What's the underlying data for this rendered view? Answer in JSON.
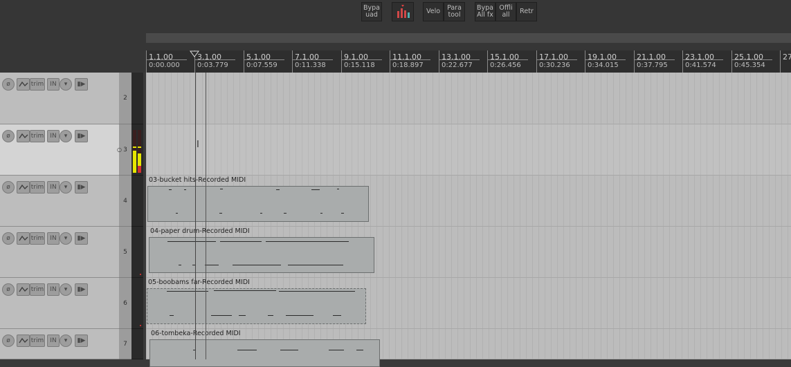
{
  "toolbar": {
    "buttons": [
      {
        "label": "Bypa\nuad"
      },
      {
        "label": "Velo"
      },
      {
        "label": "Para\ntool"
      },
      {
        "label": "Bypa\nAll fx"
      },
      {
        "label": "Offli\nall"
      },
      {
        "label": "Retr"
      }
    ]
  },
  "ruler": {
    "ticks": [
      {
        "bar": "1.1.00",
        "time": "0:00.000"
      },
      {
        "bar": "3.1.00",
        "time": "0:03.779"
      },
      {
        "bar": "5.1.00",
        "time": "0:07.559"
      },
      {
        "bar": "7.1.00",
        "time": "0:11.338"
      },
      {
        "bar": "9.1.00",
        "time": "0:15.118"
      },
      {
        "bar": "11.1.00",
        "time": "0:18.897"
      },
      {
        "bar": "13.1.00",
        "time": "0:22.677"
      },
      {
        "bar": "15.1.00",
        "time": "0:26.456"
      },
      {
        "bar": "17.1.00",
        "time": "0:30.236"
      },
      {
        "bar": "19.1.00",
        "time": "0:34.015"
      },
      {
        "bar": "21.1.00",
        "time": "0:37.795"
      },
      {
        "bar": "23.1.00",
        "time": "0:41.574"
      },
      {
        "bar": "25.1.00",
        "time": "0:45.354"
      },
      {
        "bar": "27",
        "time": ""
      }
    ]
  },
  "tracks": [
    {
      "number": "2",
      "trim": "trim",
      "input": "IN",
      "item": ""
    },
    {
      "number": "3",
      "trim": "trim",
      "input": "IN",
      "item": "",
      "selected": true
    },
    {
      "number": "4",
      "trim": "trim",
      "input": "IN",
      "item": "03-bucket hits-Recorded MIDI"
    },
    {
      "number": "5",
      "trim": "trim",
      "input": "IN",
      "item": "04-paper drum-Recorded MIDI"
    },
    {
      "number": "6",
      "trim": "trim",
      "input": "IN",
      "item": "05-boobams far-Recorded MIDI"
    },
    {
      "number": "7",
      "trim": "trim",
      "input": "IN",
      "item": "06-tombeka-Recorded MIDI"
    }
  ]
}
